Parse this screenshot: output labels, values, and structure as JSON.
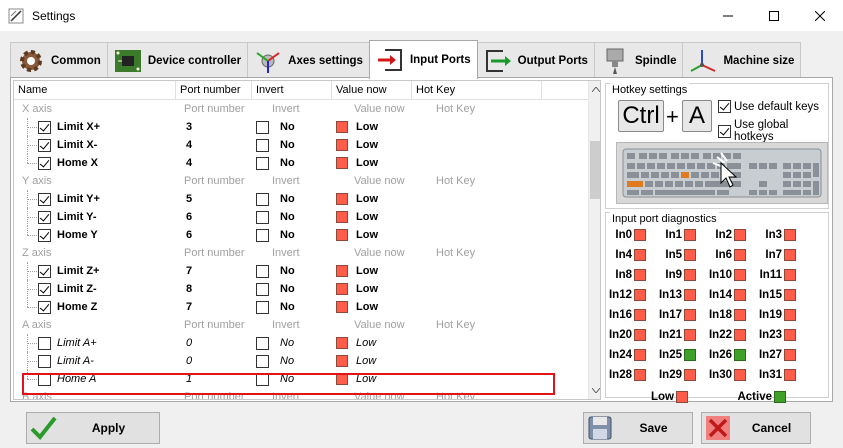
{
  "window": {
    "title": "Settings"
  },
  "tabs": [
    {
      "label": "Common",
      "icon": "gear-icon"
    },
    {
      "label": "Device controller",
      "icon": "circuit-board-icon"
    },
    {
      "label": "Axes settings",
      "icon": "axes-icon"
    },
    {
      "label": "Input Ports",
      "icon": "input-arrow-icon"
    },
    {
      "label": "Output Ports",
      "icon": "output-arrow-icon"
    },
    {
      "label": "Spindle",
      "icon": "spindle-icon"
    },
    {
      "label": "Machine size",
      "icon": "machine-axes-icon"
    }
  ],
  "active_tab": "Input Ports",
  "grid": {
    "headers": {
      "name": "Name",
      "port": "Port number",
      "invert": "Invert",
      "value": "Value now",
      "hotkey": "Hot Key"
    },
    "groups": [
      {
        "title": "X axis",
        "items": [
          {
            "name": "Limit X+",
            "port": "3",
            "invert": "No",
            "value": "Low",
            "enabled": true
          },
          {
            "name": "Limit X-",
            "port": "4",
            "invert": "No",
            "value": "Low",
            "enabled": true
          },
          {
            "name": "Home X",
            "port": "4",
            "invert": "No",
            "value": "Low",
            "enabled": true
          }
        ]
      },
      {
        "title": "Y axis",
        "items": [
          {
            "name": "Limit Y+",
            "port": "5",
            "invert": "No",
            "value": "Low",
            "enabled": true
          },
          {
            "name": "Limit Y-",
            "port": "6",
            "invert": "No",
            "value": "Low",
            "enabled": true
          },
          {
            "name": "Home Y",
            "port": "6",
            "invert": "No",
            "value": "Low",
            "enabled": true
          }
        ]
      },
      {
        "title": "Z axis",
        "items": [
          {
            "name": "Limit Z+",
            "port": "7",
            "invert": "No",
            "value": "Low",
            "enabled": true
          },
          {
            "name": "Limit Z-",
            "port": "8",
            "invert": "No",
            "value": "Low",
            "enabled": true
          },
          {
            "name": "Home Z",
            "port": "7",
            "invert": "No",
            "value": "Low",
            "enabled": true,
            "highlighted": true
          }
        ]
      },
      {
        "title": "A axis",
        "items": [
          {
            "name": "Limit A+",
            "port": "0",
            "invert": "No",
            "value": "Low",
            "enabled": false
          },
          {
            "name": "Limit A-",
            "port": "0",
            "invert": "No",
            "value": "Low",
            "enabled": false
          },
          {
            "name": "Home A",
            "port": "1",
            "invert": "No",
            "value": "Low",
            "enabled": false
          }
        ]
      },
      {
        "title": "B axis",
        "items": []
      }
    ]
  },
  "hotkeys": {
    "group_title": "Hotkey settings",
    "key1": "Ctrl",
    "plus": "+",
    "key2": "A",
    "use_default_label": "Use default keys",
    "use_default_checked": true,
    "use_global_label": "Use global hotkeys",
    "use_global_checked": true
  },
  "diagnostics": {
    "group_title": "Input port diagnostics",
    "ports": [
      {
        "label": "In0",
        "on": false
      },
      {
        "label": "In1",
        "on": false
      },
      {
        "label": "In2",
        "on": false
      },
      {
        "label": "In3",
        "on": false
      },
      {
        "label": "In4",
        "on": false
      },
      {
        "label": "In5",
        "on": false
      },
      {
        "label": "In6",
        "on": false
      },
      {
        "label": "In7",
        "on": false
      },
      {
        "label": "In8",
        "on": false
      },
      {
        "label": "In9",
        "on": false
      },
      {
        "label": "In10",
        "on": false
      },
      {
        "label": "In11",
        "on": false
      },
      {
        "label": "In12",
        "on": false
      },
      {
        "label": "In13",
        "on": false
      },
      {
        "label": "In14",
        "on": false
      },
      {
        "label": "In15",
        "on": false
      },
      {
        "label": "In16",
        "on": false
      },
      {
        "label": "In17",
        "on": false
      },
      {
        "label": "In18",
        "on": false
      },
      {
        "label": "In19",
        "on": false
      },
      {
        "label": "In20",
        "on": false
      },
      {
        "label": "In21",
        "on": false
      },
      {
        "label": "In22",
        "on": false
      },
      {
        "label": "In23",
        "on": false
      },
      {
        "label": "In24",
        "on": false
      },
      {
        "label": "In25",
        "on": true
      },
      {
        "label": "In26",
        "on": true
      },
      {
        "label": "In27",
        "on": false
      },
      {
        "label": "In28",
        "on": false
      },
      {
        "label": "In29",
        "on": false
      },
      {
        "label": "In30",
        "on": false
      },
      {
        "label": "In31",
        "on": false
      }
    ],
    "low_label": "Low",
    "active_label": "Active"
  },
  "buttons": {
    "apply": "Apply",
    "save": "Save",
    "cancel": "Cancel"
  },
  "colors": {
    "led_off": "#ff5c4a",
    "led_on": "#3ea028",
    "highlight": "#e0141a"
  }
}
